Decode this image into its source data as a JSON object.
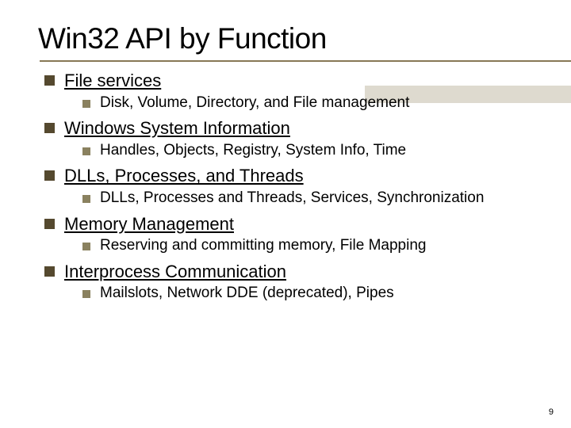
{
  "title": "Win32 API by Function",
  "items": [
    {
      "label": "File services",
      "sub": [
        "Disk, Volume, Directory, and File management"
      ]
    },
    {
      "label": "Windows System Information",
      "sub": [
        "Handles, Objects, Registry, System Info, Time"
      ]
    },
    {
      "label": "DLLs, Processes, and Threads",
      "sub": [
        "DLLs, Processes and Threads, Services, Synchronization"
      ]
    },
    {
      "label": "Memory Management",
      "sub": [
        "Reserving and committing memory, File Mapping"
      ]
    },
    {
      "label": "Interprocess Communication",
      "sub": [
        "Mailslots, Network DDE (deprecated), Pipes"
      ]
    }
  ],
  "page_number": "9"
}
